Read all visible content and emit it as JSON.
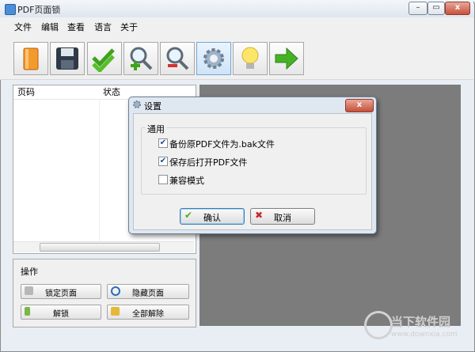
{
  "window": {
    "title": "PDF页面锁",
    "controls": [
      "minimize",
      "restore",
      "close"
    ]
  },
  "menu": {
    "items": [
      "文件",
      "编辑",
      "查看",
      "语言",
      "关于"
    ]
  },
  "toolbar": {
    "icons": [
      "open-book-icon",
      "save-disk-icon",
      "check-all-icon",
      "zoom-in-icon",
      "zoom-out-icon",
      "settings-gear-icon",
      "lightbulb-icon",
      "go-arrow-icon"
    ],
    "selected": "settings-gear-icon"
  },
  "list": {
    "columns": [
      "页码",
      "状态"
    ]
  },
  "ops": {
    "title": "操作",
    "buttons": [
      "锁定页面",
      "隐藏页面",
      "解锁",
      "全部解除"
    ]
  },
  "dialog": {
    "title": "设置",
    "close_label": "x",
    "group_title": "通用",
    "options": [
      {
        "label": "备份原PDF文件为.bak文件",
        "checked": true
      },
      {
        "label": "保存后打开PDF文件",
        "checked": true
      },
      {
        "label": "兼容模式",
        "checked": false
      }
    ],
    "ok_label": "确认",
    "cancel_label": "取消"
  },
  "watermark": {
    "text": "当下软件园",
    "url": "www.downxia.com"
  },
  "colors": {
    "accent_selected": "#cfe4f7",
    "gray_area": "#7c7c7c",
    "close_red": "#c8513c",
    "check_green": "#4caf1e",
    "cancel_red": "#c62a2a"
  }
}
